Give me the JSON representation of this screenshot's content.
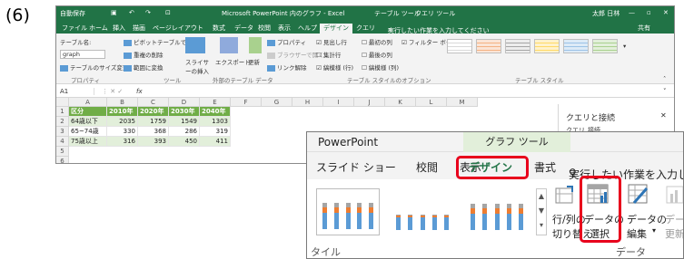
{
  "step_label": "(6)",
  "excel": {
    "title": "Microsoft PowerPoint 内のグラフ - Excel",
    "autosave": "自動保存",
    "context_tabs": [
      "テーブル ツール",
      "クエリ ツール"
    ],
    "user": "太郎 日林",
    "tabs": [
      "ファイル",
      "ホーム",
      "挿入",
      "描画",
      "ページレイアウト",
      "数式",
      "データ",
      "校閲",
      "表示",
      "ヘルプ",
      "デザイン",
      "クエリ"
    ],
    "active_tab": "デザイン",
    "tell_me": "実行したい作業を入力してください",
    "share": "共有",
    "ribbon": {
      "table_name_label": "テーブル名:",
      "table_name_value": "graph",
      "resize": "テーブルのサイズ変更",
      "group_properties": "プロパティ",
      "pivot": "ピボットテーブルで集計",
      "remove_dup": "重複の削除",
      "convert_range": "範囲に変換",
      "group_tools": "ツール",
      "slicer": "スライサーの挿入",
      "export": "エクスポート",
      "refresh": "更新",
      "properties_btn": "プロパティ",
      "open_browser": "ブラウザーで開く",
      "unlink": "リンク解除",
      "group_external": "外部のテーブル データ",
      "opt_header": "見出し行",
      "opt_total": "集計行",
      "opt_banded": "縞模様 (行)",
      "opt_first": "最初の列",
      "opt_last": "最後の列",
      "opt_banded_col": "縞模様 (列)",
      "opt_filter": "フィルター ボタン",
      "group_style_opts": "テーブル スタイルのオプション",
      "group_styles": "テーブル スタイル"
    },
    "name_box": "A1",
    "fx": "fx",
    "columns": [
      "A",
      "B",
      "C",
      "D",
      "E",
      "F",
      "G",
      "H",
      "I",
      "J",
      "K",
      "L",
      "M"
    ],
    "rows": [
      "1",
      "2",
      "3",
      "4",
      "5",
      "6"
    ],
    "table_header": [
      "区分",
      "2010年",
      "2020年",
      "2030年",
      "2040年"
    ],
    "table_rows": [
      [
        "64歳以下",
        "2035",
        "1759",
        "1549",
        "1303"
      ],
      [
        "65~74歳",
        "330",
        "368",
        "286",
        "319"
      ],
      [
        "75歳以上",
        "316",
        "393",
        "450",
        "411"
      ]
    ],
    "pane_title": "クエリと接続",
    "pane_tabs": [
      "クエリ",
      "接続"
    ]
  },
  "ppt": {
    "app_name": "PowerPoint",
    "tool_tab": "グラフ ツール",
    "tabs": [
      "スライド ショー",
      "校閲",
      "表示",
      "デザイン",
      "書式"
    ],
    "tell_me": "実行したい作業を入力し",
    "group_style_label": "タイル",
    "btn_switch_line1": "行/列の",
    "btn_switch_line2": "切り替え",
    "btn_select_line1": "データの",
    "btn_select_line2": "選択",
    "btn_edit_line1": "データの",
    "btn_edit_line2": "編集",
    "btn_refresh_line1": "データの",
    "btn_refresh_line2": "更新",
    "group_data": "データ",
    "highlight_color": "#e8001c"
  },
  "colors": {
    "excel_green": "#217346",
    "table_header_green": "#70ad47",
    "band_green": "#e2efda",
    "chart_blue": "#5b9bd5",
    "chart_orange": "#ed7d31",
    "chart_gray": "#a5a5a5"
  }
}
